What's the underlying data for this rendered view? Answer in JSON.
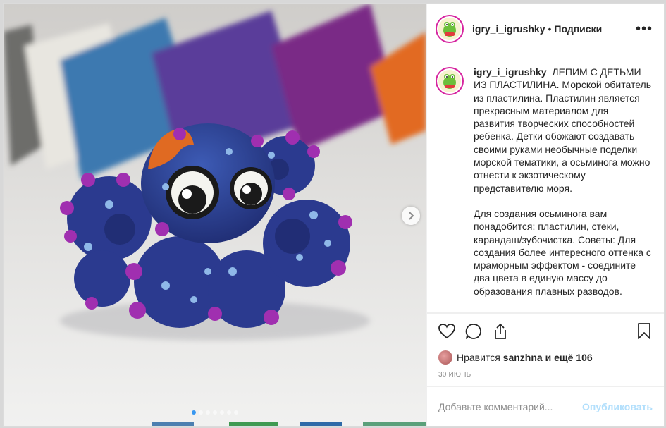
{
  "post": {
    "username": "igry_i_igrushky",
    "separator": "•",
    "follow_label": "Подписки",
    "more_label": "•••",
    "caption_head": "ЛЕПИМ С ДЕТЬМИ ИЗ ПЛАСТИЛИНА. Морской обитатель из пластилина. Пластилин является прекрасным материалом для развития творческих способностей ребенка. Детки обожают создавать своими руками необычные поделки морской тематики, а осьминога можно отнести к экзотическому представителю моря.",
    "caption_body": "Для создания осьминога вам понадобится: пластилин, стеки, карандаш/зубочистка. Советы: Для создания более интересного оттенка с мраморным эффектом - соедините два цвета в единую массу до образования плавных разводов.",
    "likes_prefix": "Нравится",
    "likes_user": "sanzhna",
    "likes_suffix": "и ещё 106",
    "date": "30 июнь",
    "comment_placeholder": "Добавьте комментарий...",
    "publish_label": "Опубликовать"
  },
  "media": {
    "slide_count": 7,
    "active_slide": 1
  },
  "icons": {
    "like": "heart-icon",
    "comment": "comment-icon",
    "share": "share-icon",
    "save": "bookmark-icon",
    "next": "chevron-right-icon"
  },
  "colors": {
    "accent": "#3897f0",
    "publish_disabled": "#b2dffc",
    "story_ring": "#d6249f"
  }
}
